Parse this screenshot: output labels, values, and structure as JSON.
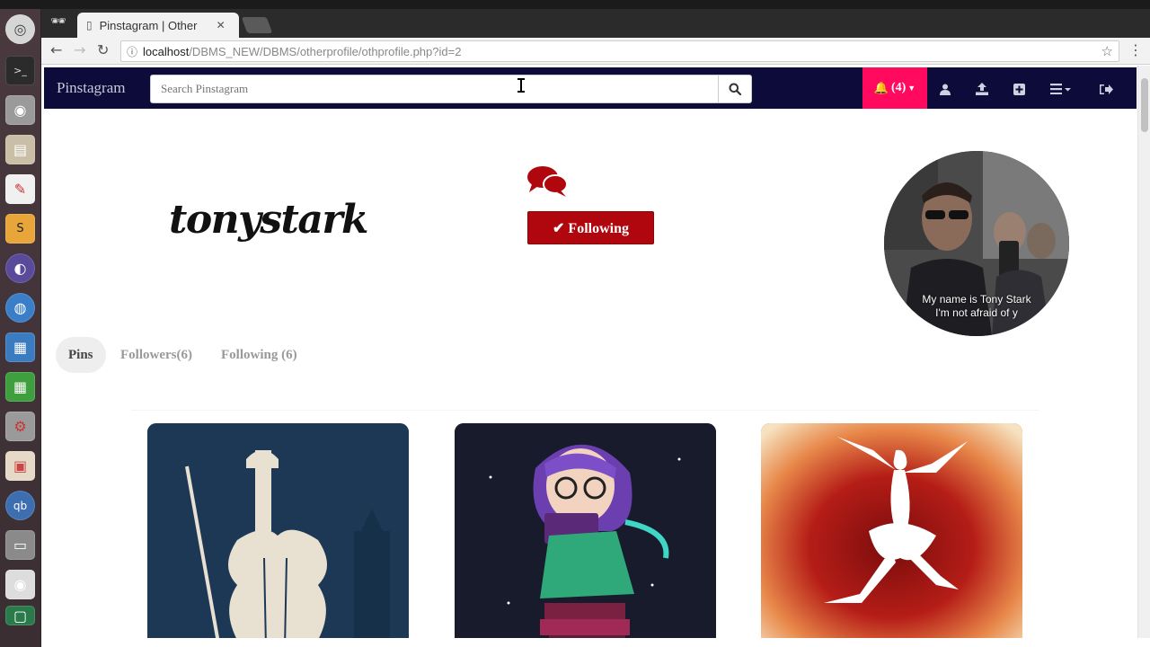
{
  "browser": {
    "tab_title": "Pinstagram | Other",
    "url_host": "localhost",
    "url_path": "/DBMS_NEW/DBMS/otherprofile/othprofile.php?id=2"
  },
  "site": {
    "brand": "Pinstagram",
    "search_placeholder": "Search Pinstagram",
    "notifications_label": "(4)"
  },
  "profile": {
    "username": "tonystark",
    "follow_label": "✔ Following",
    "avatar_caption_line1": "My name is Tony Stark",
    "avatar_caption_line2": "I'm not afraid of y"
  },
  "profile_tabs": [
    {
      "label": "Pins",
      "active": true
    },
    {
      "label": "Followers(6)",
      "active": false
    },
    {
      "label": "Following (6)",
      "active": false
    }
  ],
  "pins": [
    {
      "name": "violin-pin"
    },
    {
      "name": "reading-girl-pin"
    },
    {
      "name": "dancer-pin"
    }
  ],
  "colors": {
    "navbar": "#0c0b3a",
    "notification": "#ff0a5e",
    "follow_button": "#b0070e"
  }
}
